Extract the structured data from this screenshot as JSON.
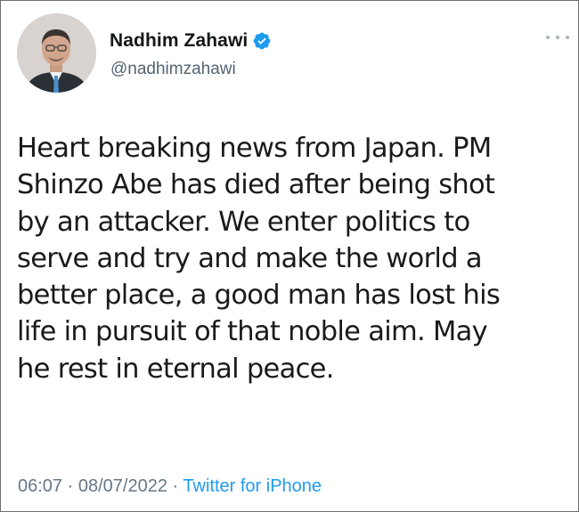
{
  "tweet": {
    "author": {
      "display_name": "Nadhim Zahawi",
      "handle": "@nadhimzahawi",
      "verified": true
    },
    "text_lines": [
      "Heart breaking news from Japan. PM",
      "Shinzo Abe has died after being shot",
      "by an attacker. We enter politics to",
      "serve and try and make the world a",
      "better place, a good man has lost his",
      "life in pursuit of that noble aim. May",
      "he rest in eternal peace."
    ],
    "time": "06:07",
    "separator": "·",
    "date": "08/07/2022",
    "source": "Twitter for iPhone"
  },
  "icons": {
    "verified": "verified-badge-icon",
    "more": "more-options-icon"
  },
  "colors": {
    "verified_badge": "#1d9bf0",
    "source_link": "#1d9bf0",
    "meta_text": "#657786"
  }
}
